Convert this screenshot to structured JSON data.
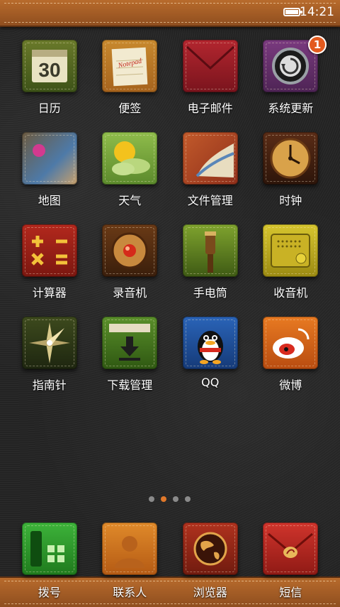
{
  "status_bar": {
    "time": "14:21",
    "battery_level": 1.0
  },
  "apps": [
    {
      "name": "日历",
      "icon": "calendar-icon",
      "extra": "30"
    },
    {
      "name": "便签",
      "icon": "notepad-icon",
      "extra": "Notepad"
    },
    {
      "name": "电子邮件",
      "icon": "envelope-icon"
    },
    {
      "name": "系统更新",
      "icon": "system-update-icon",
      "badge": "1"
    },
    {
      "name": "地图",
      "icon": "map-icon"
    },
    {
      "name": "天气",
      "icon": "weather-sun-cloud-icon"
    },
    {
      "name": "文件管理",
      "icon": "folder-icon"
    },
    {
      "name": "时钟",
      "icon": "clock-icon"
    },
    {
      "name": "计算器",
      "icon": "calculator-icon"
    },
    {
      "name": "录音机",
      "icon": "recorder-icon"
    },
    {
      "name": "手电筒",
      "icon": "flashlight-icon"
    },
    {
      "name": "收音机",
      "icon": "radio-icon"
    },
    {
      "name": "指南针",
      "icon": "compass-icon"
    },
    {
      "name": "下载管理",
      "icon": "download-icon"
    },
    {
      "name": "QQ",
      "icon": "qq-penguin-icon"
    },
    {
      "name": "微博",
      "icon": "weibo-icon"
    }
  ],
  "page_indicator": {
    "total": 4,
    "active_index": 1
  },
  "dock": [
    {
      "name": "拨号",
      "icon": "phone-dialer-icon"
    },
    {
      "name": "联系人",
      "icon": "contacts-icon"
    },
    {
      "name": "浏览器",
      "icon": "globe-browser-icon"
    },
    {
      "name": "短信",
      "icon": "message-envelope-icon"
    }
  ]
}
